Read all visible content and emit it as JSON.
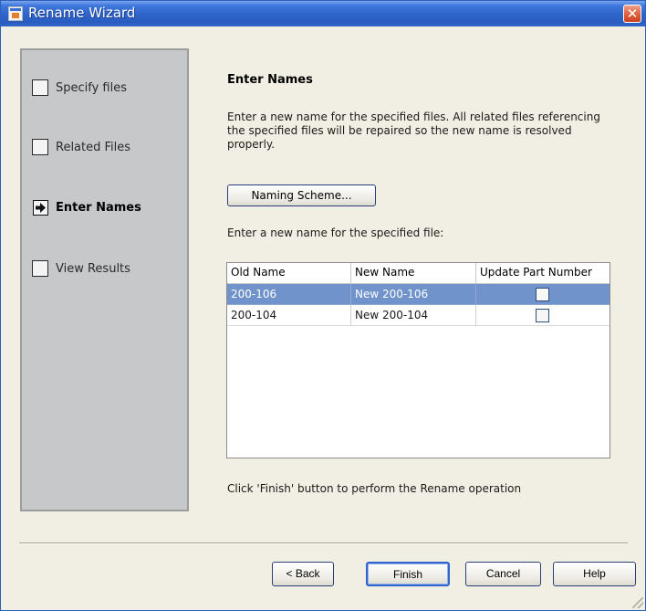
{
  "window": {
    "title": "Rename Wizard",
    "close_glyph": "✕"
  },
  "steps": [
    {
      "label": "Specify files",
      "state": "pending"
    },
    {
      "label": "Related Files",
      "state": "pending"
    },
    {
      "label": "Enter Names",
      "state": "current"
    },
    {
      "label": "View Results",
      "state": "pending"
    }
  ],
  "main": {
    "heading": "Enter Names",
    "description": "Enter a new name for the specified files.  All related files referencing the specified files will be repaired so the new name is resolved properly.",
    "naming_button": "Naming Scheme...",
    "table_caption": "Enter a new name for the specified file:",
    "columns": [
      "Old Name",
      "New Name",
      "Update Part Number"
    ],
    "rows": [
      {
        "old": "200-106",
        "new": "New 200-106",
        "update": false,
        "selected": true
      },
      {
        "old": "200-104",
        "new": "New 200-104",
        "update": false,
        "selected": false
      }
    ],
    "footer_note": "Click 'Finish' button to perform the Rename operation"
  },
  "buttons": {
    "back": "< Back",
    "finish": "Finish",
    "cancel": "Cancel",
    "help": "Help"
  },
  "colors": {
    "titlebar": "#2e63c8",
    "selection": "#6f93ca",
    "sidebar": "#c6c8ca",
    "dialog": "#f1efe3"
  },
  "icons": {
    "current_step": "arrow-right-icon",
    "pending_step": "checkbox-icon"
  }
}
